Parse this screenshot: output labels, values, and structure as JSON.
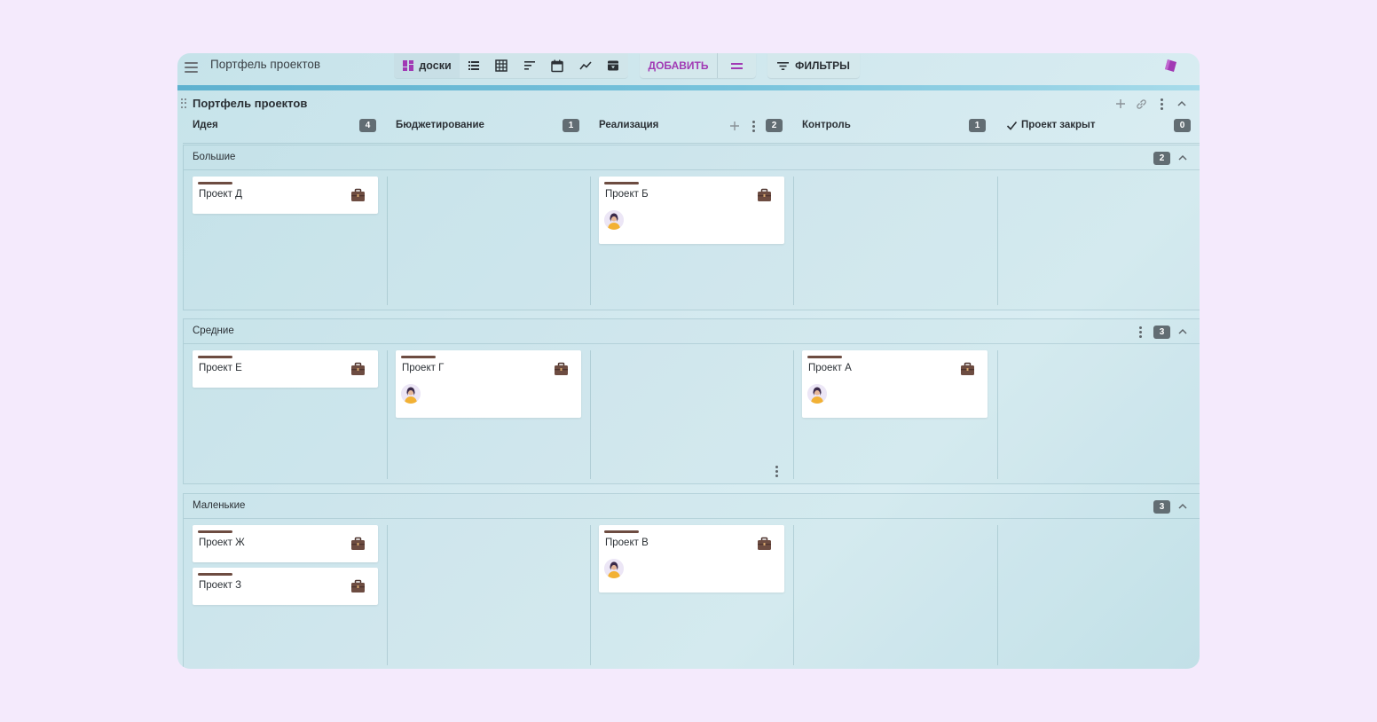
{
  "app": {
    "title": "Портфель проектов",
    "accent_color": "#a13ab4",
    "badge_color": "#626d73"
  },
  "toolbar": {
    "views": [
      {
        "name": "boards",
        "label": "доски",
        "icon": "board-view-icon",
        "active": true
      },
      {
        "name": "list",
        "icon": "list-view-icon"
      },
      {
        "name": "table",
        "icon": "table-view-icon"
      },
      {
        "name": "gantt",
        "icon": "gantt-view-icon"
      },
      {
        "name": "calendar",
        "icon": "calendar-icon"
      },
      {
        "name": "chart",
        "icon": "chart-icon"
      },
      {
        "name": "archive",
        "icon": "archive-icon"
      }
    ],
    "add_label": "ДОБАВИТЬ",
    "filters_label": "ФИЛЬТРЫ"
  },
  "board": {
    "title": "Портфель проектов",
    "columns": [
      {
        "name": "Идея",
        "count": "4"
      },
      {
        "name": "Бюджетирование",
        "count": "1"
      },
      {
        "name": "Реализация",
        "count": "2"
      },
      {
        "name": "Контроль",
        "count": "1"
      },
      {
        "name": "Проект закрыт",
        "count": "0",
        "check": true
      }
    ],
    "lanes": [
      {
        "title": "Большие",
        "count": "2",
        "cards": [
          {
            "title": "Проект Д",
            "column": 0,
            "avatar": false
          },
          {
            "title": "Проект Б",
            "column": 2,
            "avatar": true
          }
        ]
      },
      {
        "title": "Средние",
        "count": "3",
        "cards": [
          {
            "title": "Проект Е",
            "column": 0,
            "avatar": false
          },
          {
            "title": "Проект Г",
            "column": 1,
            "avatar": true
          },
          {
            "title": "Проект А",
            "column": 3,
            "avatar": true
          }
        ]
      },
      {
        "title": "Маленькие",
        "count": "3",
        "cards": [
          {
            "title": "Проект Ж",
            "column": 0,
            "avatar": false
          },
          {
            "title": "Проект З",
            "column": 0,
            "avatar": false
          },
          {
            "title": "Проект В",
            "column": 2,
            "avatar": true
          }
        ]
      }
    ]
  }
}
